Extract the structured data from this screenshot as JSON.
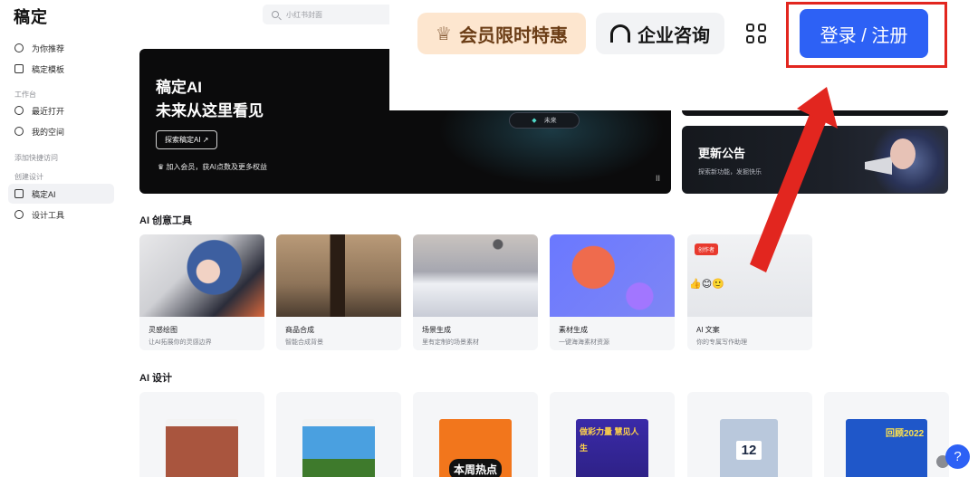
{
  "app": {
    "logo": "稿定"
  },
  "sidebar": {
    "items": [
      {
        "label": "为你推荐",
        "icon": "compass-icon"
      },
      {
        "label": "稿定模板",
        "icon": "template-icon"
      }
    ],
    "workspace_title": "工作台",
    "workspace_items": [
      {
        "label": "最近打开",
        "icon": "clock-icon"
      },
      {
        "label": "我的空间",
        "icon": "user-space-icon"
      }
    ],
    "quick_access": "添加快捷访问",
    "create_title": "创建设计",
    "create_items": [
      {
        "label": "稿定AI",
        "icon": "ai-scan-icon",
        "active": true
      },
      {
        "label": "设计工具",
        "icon": "design-tool-icon"
      }
    ]
  },
  "search": {
    "placeholder": "小红书封面"
  },
  "topbar": {
    "vip_label": "会员限时特惠",
    "enterprise_label": "企业咨询",
    "login_label": "登录 / 注册"
  },
  "banner": {
    "title_line1": "稿定AI",
    "title_line2": "未来从这里看见",
    "explore_label": "探索稿定AI ↗",
    "vip_line": "加入会员，获AI点数及更多权益",
    "pill_label": "未来",
    "pause": "II"
  },
  "news": {
    "title": "更新公告",
    "subtitle": "探索新功能，发掘快乐"
  },
  "ai_tools": {
    "title": "AI 创意工具",
    "cards": [
      {
        "title": "灵感绘图",
        "desc": "让AI拓展你的灵感边界"
      },
      {
        "title": "商品合成",
        "desc": "智能合成背景"
      },
      {
        "title": "场景生成",
        "desc": "里有定制的场景素材"
      },
      {
        "title": "素材生成",
        "desc": "一键海海素材资源"
      },
      {
        "title": "AI 文案",
        "desc": "你的专属写作助理",
        "badge": "创作者"
      }
    ]
  },
  "ai_design": {
    "title": "AI 设计",
    "cards": [
      {
        "text": ""
      },
      {
        "text": ""
      },
      {
        "text": "本周热点"
      },
      {
        "text": "做彩力量 慧见人生"
      },
      {
        "text": "12"
      },
      {
        "text": "回顾2022"
      }
    ]
  },
  "help": {
    "label": "?"
  },
  "colors": {
    "accent": "#2d61f5",
    "highlight": "#e2261f",
    "vip_bg": "#fde6cf"
  }
}
